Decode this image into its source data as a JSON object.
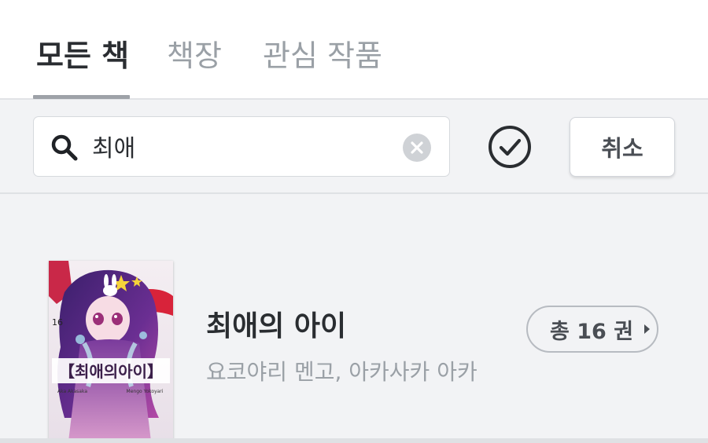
{
  "tabs": [
    {
      "label": "모든 책",
      "active": true
    },
    {
      "label": "책장",
      "active": false
    },
    {
      "label": "관심 작품",
      "active": false
    }
  ],
  "search": {
    "query": "최애",
    "icon": "search-icon",
    "clear_icon": "clear-circle-icon"
  },
  "toolbar": {
    "select_icon": "check-circle-icon",
    "cancel_label": "취소"
  },
  "books": [
    {
      "title": "최애의 아이",
      "authors": "요코야리 멘고, 아카사카 아카",
      "volume_label": "총 16 권",
      "cover": {
        "volume_number": "16",
        "title": "【최애의아이】",
        "author_left": "Aka Akasaka",
        "author_right": "Mengo Yokoyari"
      }
    }
  ],
  "colors": {
    "text_primary": "#2a2d31",
    "text_muted": "#9aa0a6",
    "background": "#f2f3f5",
    "divider": "#dfe1e4"
  }
}
